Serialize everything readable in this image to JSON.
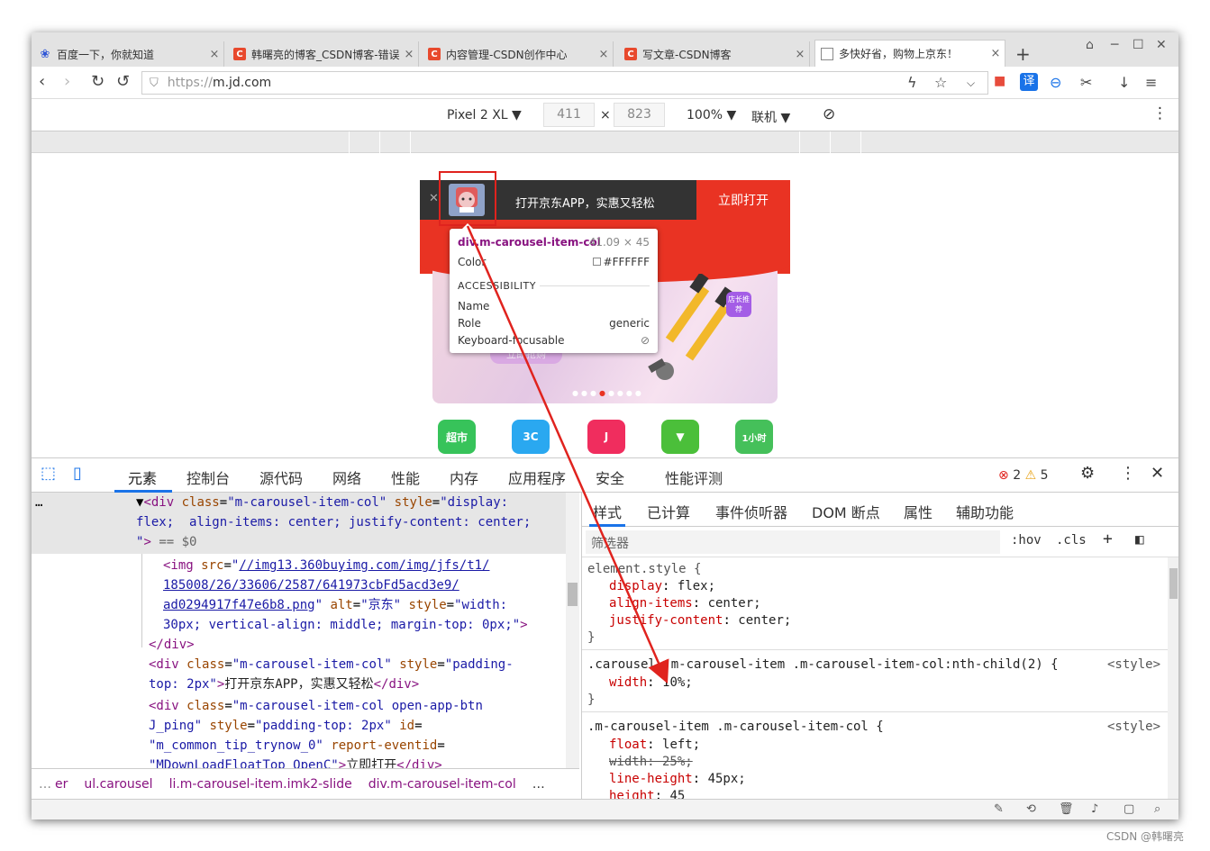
{
  "browser": {
    "tabs": [
      {
        "title": "百度一下，你就知道",
        "icon": "baidu-icon"
      },
      {
        "title": "韩曙亮的博客_CSDN博客-错误",
        "icon": "csdn-icon"
      },
      {
        "title": "内容管理-CSDN创作中心",
        "icon": "csdn-icon"
      },
      {
        "title": "写文章-CSDN博客",
        "icon": "csdn-icon"
      },
      {
        "title": "多快好省，购物上京东！",
        "icon": "document-icon"
      }
    ],
    "url_protocol": "https://",
    "url_host": "m.jd.com"
  },
  "device_toolbar": {
    "device": "Pixel 2 XL",
    "width": "411",
    "height": "823",
    "zoom": "100%",
    "network": "联机"
  },
  "page": {
    "banner_text": "打开京东APP，实惠又轻松",
    "banner_button": "立即打开",
    "hero_button": "立即抢购",
    "hero_tag": "店长推荐",
    "icons": [
      "超市",
      "3C",
      "J",
      "",
      "1小时"
    ]
  },
  "inspect_tooltip": {
    "element": "div.m-carousel-item-col",
    "size": "41.09 × 45",
    "color_label": "Color",
    "color_value": "#FFFFFF",
    "section": "ACCESSIBILITY",
    "name_label": "Name",
    "role_label": "Role",
    "role_value": "generic",
    "focus_label": "Keyboard-focusable"
  },
  "devtools": {
    "tabs": [
      "元素",
      "控制台",
      "源代码",
      "网络",
      "性能",
      "内存",
      "应用程序",
      "安全",
      "性能评测"
    ],
    "errors": "2",
    "warnings": "5",
    "side_tabs": [
      "样式",
      "已计算",
      "事件侦听器",
      "DOM 断点",
      "属性",
      "辅助功能"
    ],
    "filter_placeholder": "筛选器",
    "hov": ":hov",
    "cls": ".cls",
    "breadcrumbs": [
      "er",
      "ul.carousel",
      "li.m-carousel-item.imk2-slide",
      "div.m-carousel-item-col"
    ],
    "more": "…"
  },
  "colors": {
    "jd_red": "#e93323",
    "highlight_red": "#e0231e",
    "devtools_blue": "#1a73e8"
  },
  "watermark": "CSDN @韩曙亮"
}
